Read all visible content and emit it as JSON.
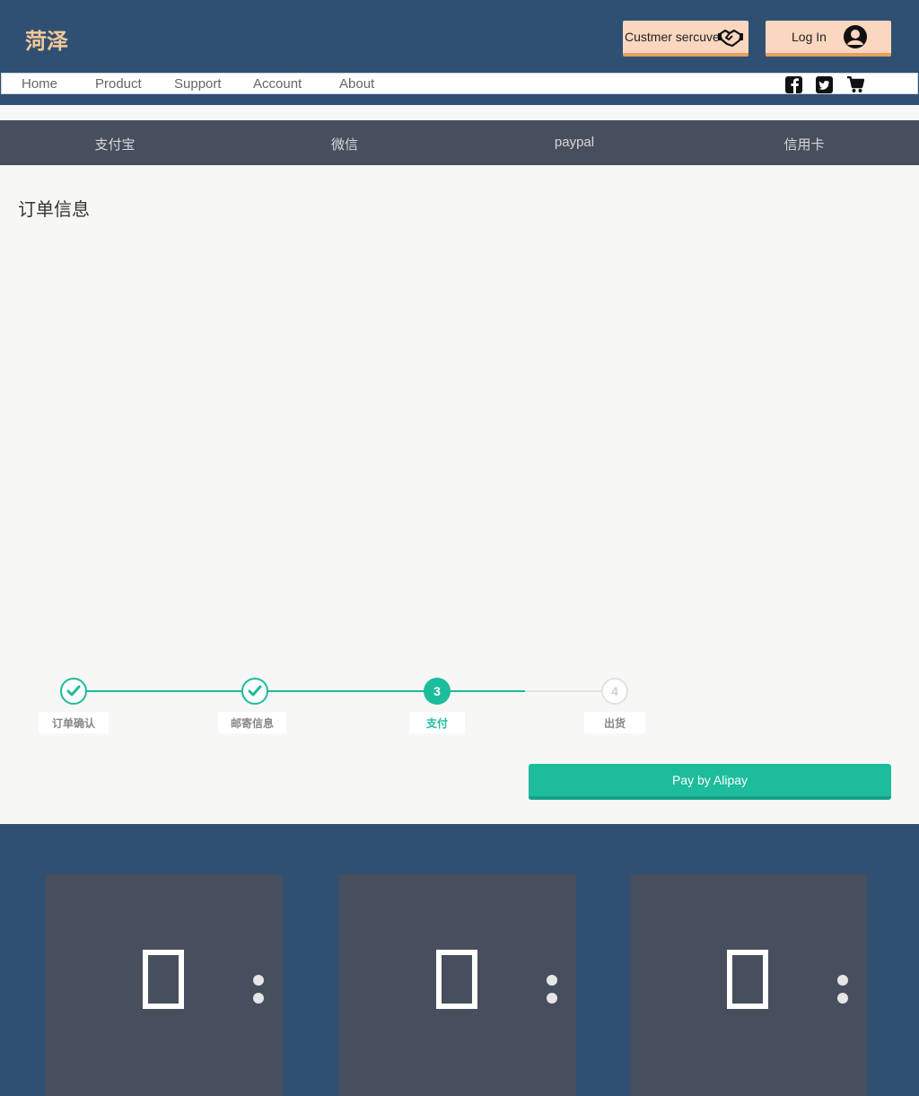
{
  "header": {
    "logo": "菏泽",
    "service_label": "Custmer sercuve",
    "login_label": "Log In",
    "brand_color": "#2f5072",
    "button_color": "#fcd7bf"
  },
  "nav": {
    "items": [
      "Home",
      "Product",
      "Support",
      "Account",
      "About"
    ],
    "icons": [
      "facebook-icon",
      "twitter-icon",
      "cart-icon"
    ]
  },
  "payment_tabs": [
    "支付宝",
    "微信",
    "paypal",
    "信用卡"
  ],
  "order": {
    "title": "订单信息"
  },
  "steps": {
    "items": [
      {
        "label": "订单确认",
        "state": "done"
      },
      {
        "label": "邮寄信息",
        "state": "done"
      },
      {
        "label": "支付",
        "number": "3",
        "state": "active"
      },
      {
        "label": "出货",
        "number": "4",
        "state": "todo"
      }
    ],
    "accent_color": "#1dbc9c"
  },
  "pay_button": {
    "label": "Pay by Alipay"
  },
  "footer": {
    "cards": 3
  }
}
